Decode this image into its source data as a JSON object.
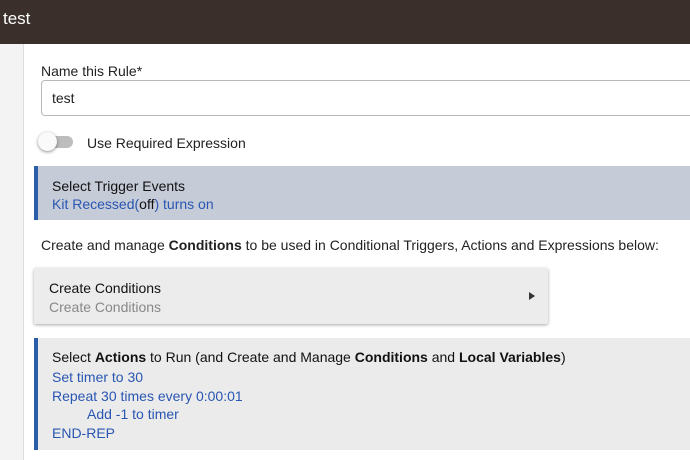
{
  "header": {
    "title": "test"
  },
  "name_field": {
    "label": "Name this Rule*",
    "value": "test"
  },
  "required_expression": {
    "label": "Use Required Expression",
    "enabled": false
  },
  "trigger": {
    "title": "Select Trigger Events",
    "link_prefix": "Kit Recessed(",
    "link_state": "off",
    "link_suffix": ") turns on"
  },
  "conditions_intro": {
    "before": "Create and manage ",
    "bold": "Conditions",
    "after": " to be used in Conditional Triggers, Actions and Expressions below:"
  },
  "create_conditions": {
    "title": "Create Conditions",
    "subtitle": "Create Conditions"
  },
  "actions": {
    "title_parts": [
      "Select ",
      "Actions",
      " to Run (and Create and Manage ",
      "Conditions",
      " and ",
      "Local Variables",
      ")"
    ],
    "lines": [
      "Set timer to 30",
      "Repeat 30 times every 0:00:01",
      "Add -1 to timer",
      "END-REP"
    ]
  },
  "colors": {
    "header_bg": "#3a2f2b",
    "accent": "#2a5ea8",
    "link": "#2956b2",
    "trigger_bg": "#c6cbd8"
  }
}
